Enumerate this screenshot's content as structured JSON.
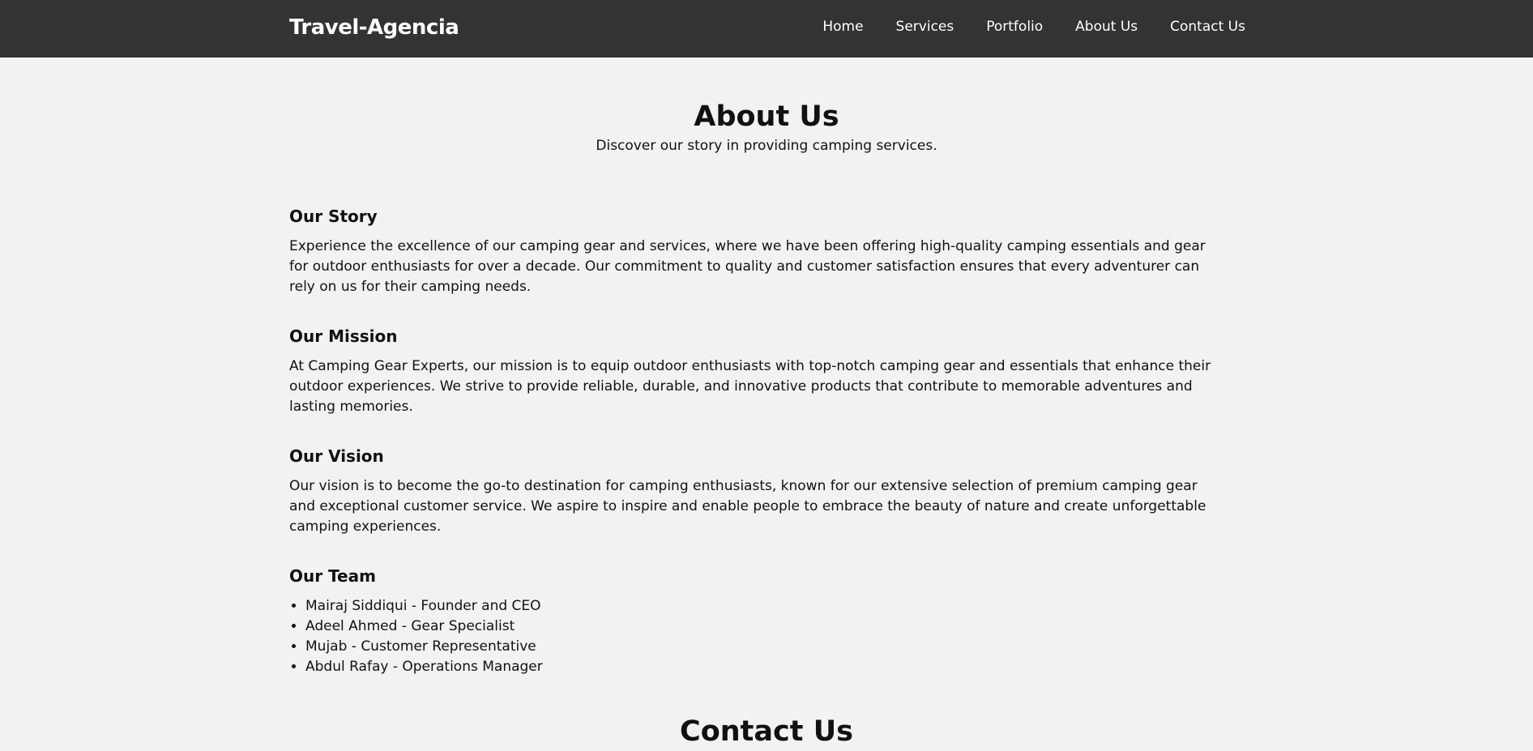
{
  "navbar": {
    "brand": "Travel-Agencia",
    "links": [
      "Home",
      "Services",
      "Portfolio",
      "About Us",
      "Contact Us"
    ]
  },
  "hero": {
    "title": "About Us",
    "subtitle": "Discover our story in providing camping services."
  },
  "sections": {
    "story": {
      "title": "Our Story",
      "text": "Experience the excellence of our camping gear and services, where we have been offering high-quality camping essentials and gear for outdoor enthusiasts for over a decade. Our commitment to quality and customer satisfaction ensures that every adventurer can rely on us for their camping needs."
    },
    "mission": {
      "title": "Our Mission",
      "text": "At Camping Gear Experts, our mission is to equip outdoor enthusiasts with top-notch camping gear and essentials that enhance their outdoor experiences. We strive to provide reliable, durable, and innovative products that contribute to memorable adventures and lasting memories."
    },
    "vision": {
      "title": "Our Vision",
      "text": "Our vision is to become the go-to destination for camping enthusiasts, known for our extensive selection of premium camping gear and exceptional customer service. We aspire to inspire and enable people to embrace the beauty of nature and create unforgettable camping experiences."
    },
    "team": {
      "title": "Our Team",
      "members": [
        "Mairaj Siddiqui - Founder and CEO",
        "Adeel Ahmed - Gear Specialist",
        "Mujab - Customer Representative",
        "Abdul Rafay - Operations Manager"
      ]
    }
  },
  "contact": {
    "title": "Contact Us"
  }
}
